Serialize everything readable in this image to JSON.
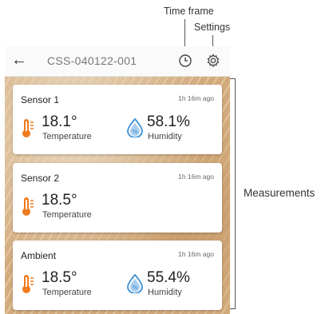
{
  "annotations": {
    "time_frame": "Time frame",
    "settings": "Settings",
    "measurements": "Measurements"
  },
  "appbar": {
    "device_id": "CSS-040122-001",
    "back_icon": "arrow-left-icon",
    "time_frame_icon": "clock-icon",
    "settings_icon": "gear-icon"
  },
  "cards": [
    {
      "title": "Sensor 1",
      "time": "1h 16m ago",
      "temperature": "18.1°",
      "temperature_label": "Temperature",
      "humidity": "58.1%",
      "humidity_label": "Humidity"
    },
    {
      "title": "Sensor 2",
      "time": "1h 16m ago",
      "temperature": "18.5°",
      "temperature_label": "Temperature"
    },
    {
      "title": "Ambient",
      "time": "1h 16m ago",
      "temperature": "18.5°",
      "temperature_label": "Temperature",
      "humidity": "55.4%",
      "humidity_label": "Humidity"
    }
  ],
  "colors": {
    "thermometer": "#f07a1e",
    "humidity": "#3a8fd6",
    "annotation_line": "#555555"
  }
}
